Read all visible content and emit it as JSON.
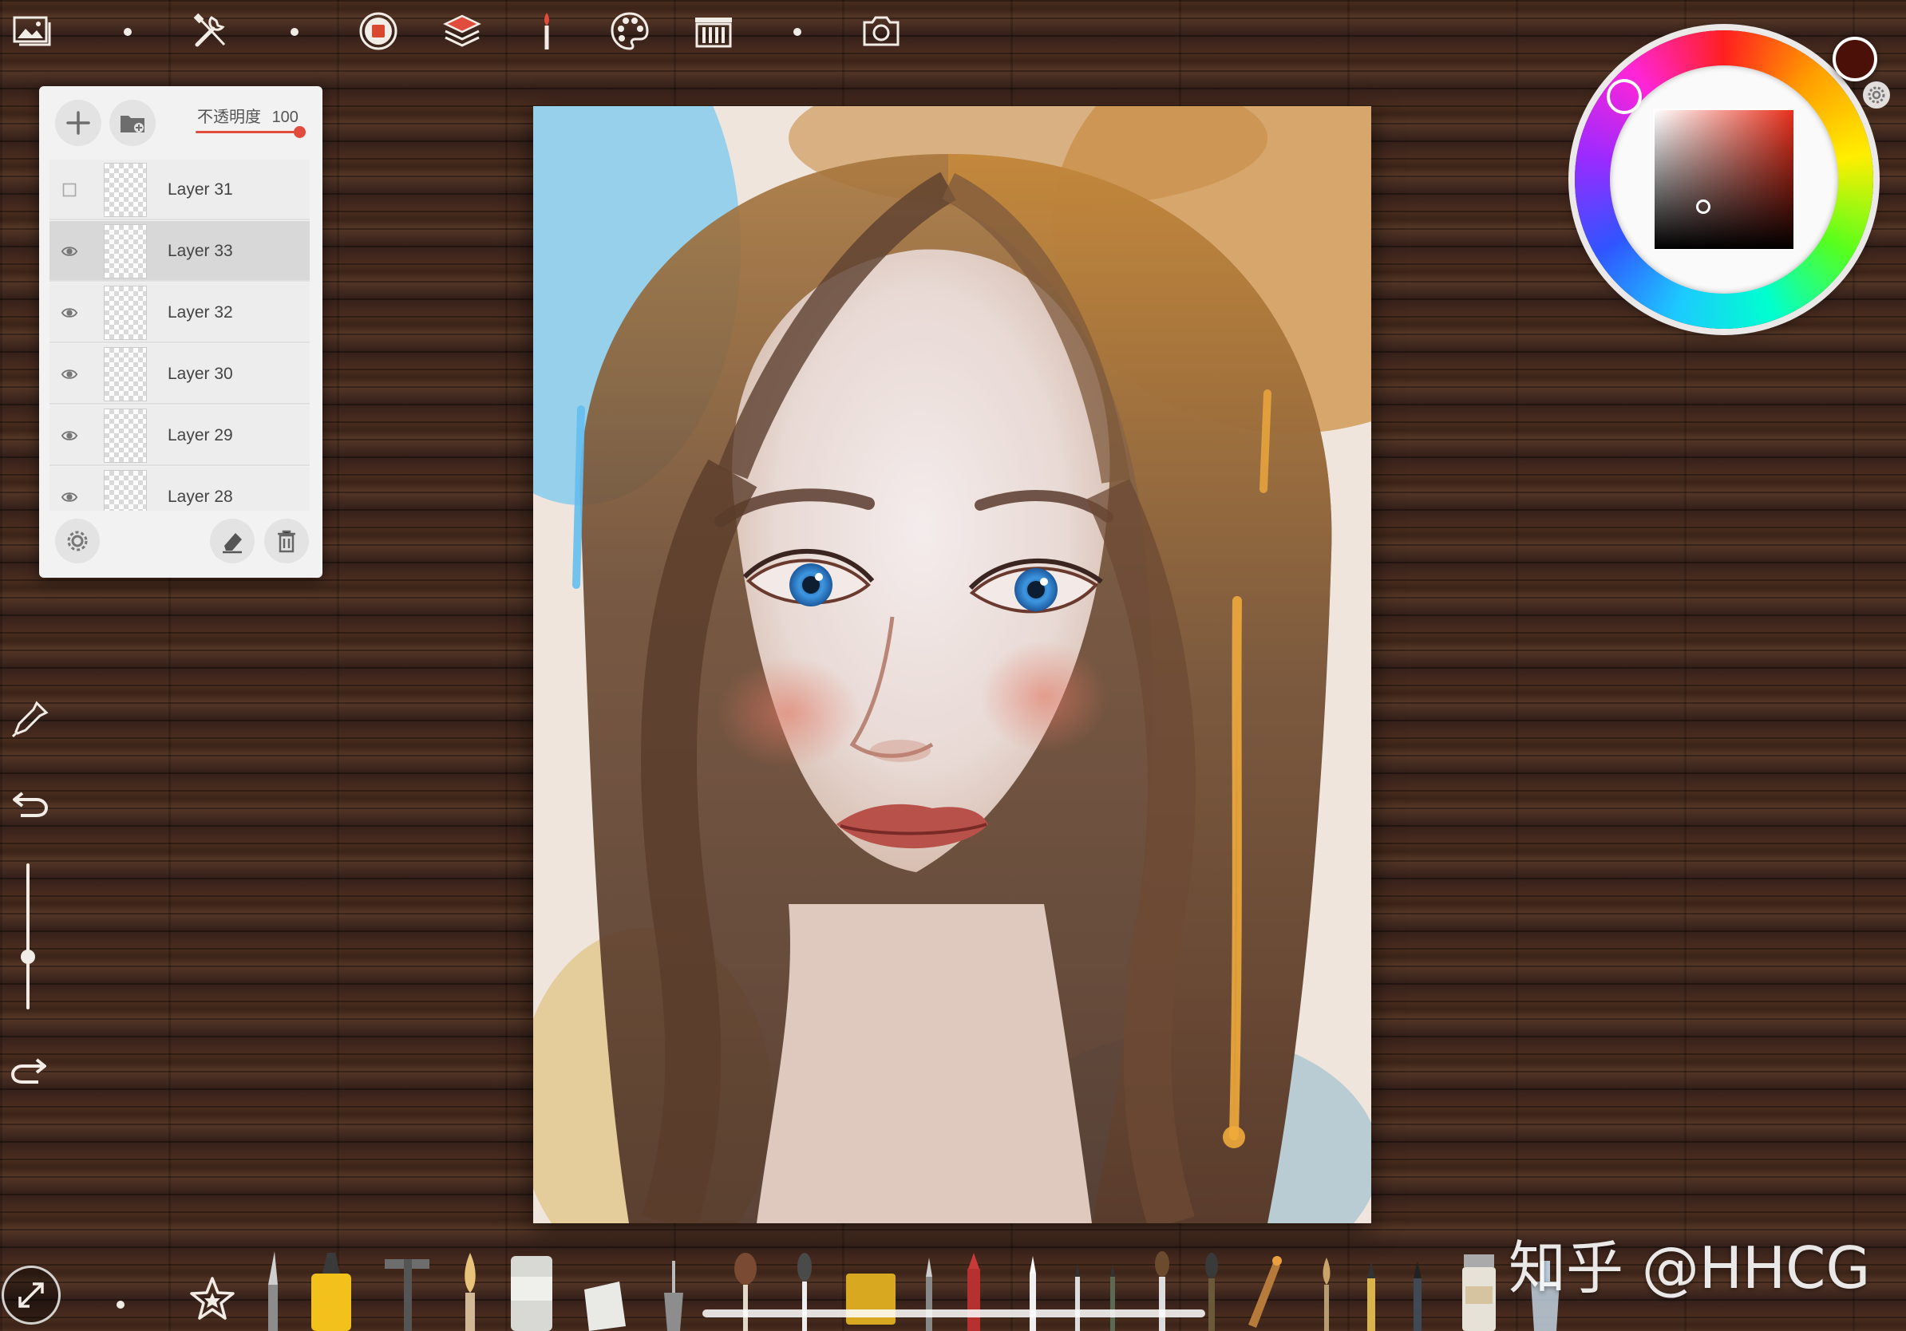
{
  "top_toolbar": {
    "items": [
      {
        "name": "gallery-icon"
      },
      {
        "name": "tools-icon"
      },
      {
        "name": "stop-record-icon"
      },
      {
        "name": "layers-icon"
      },
      {
        "name": "brush-icon"
      },
      {
        "name": "palette-icon"
      },
      {
        "name": "brush-library-icon"
      },
      {
        "name": "camera-icon"
      }
    ]
  },
  "layers_panel": {
    "opacity_label": "不透明度",
    "opacity_value": "100",
    "opacity_fraction": 1.0,
    "layers": [
      {
        "name": "Layer 31",
        "visible": false,
        "selected": false
      },
      {
        "name": "Layer 33",
        "visible": true,
        "selected": true
      },
      {
        "name": "Layer 32",
        "visible": true,
        "selected": false
      },
      {
        "name": "Layer 30",
        "visible": true,
        "selected": false
      },
      {
        "name": "Layer 29",
        "visible": true,
        "selected": false
      },
      {
        "name": "Layer 28",
        "visible": true,
        "selected": false
      }
    ]
  },
  "color": {
    "current": "#4b1108",
    "hue": "#e8301c"
  },
  "watermark": "知乎 @HHCG"
}
